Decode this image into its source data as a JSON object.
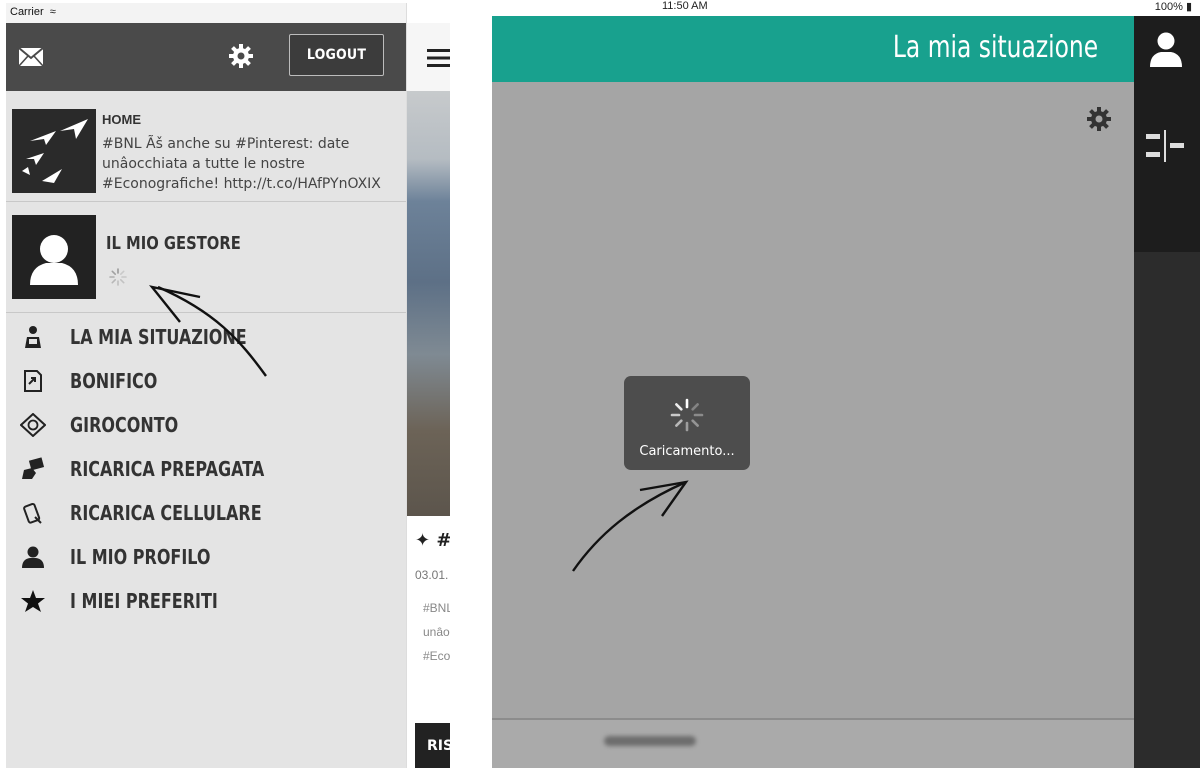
{
  "left_screen": {
    "status_bar": {
      "carrier": "Carrier"
    },
    "drawer": {
      "logout_label": "LOGOUT",
      "home": {
        "title": "HOME",
        "tweet": "#BNL Ãš anche su #Pinterest: date unâocchiata a tutte le nostre #Econografiche! http://t.co/HAfPYnOXIX"
      },
      "gestore": {
        "title": "IL MIO GESTORE"
      },
      "menu": [
        {
          "label": "LA MIA SITUAZIONE",
          "icon": "person-reading-icon"
        },
        {
          "label": "BONIFICO",
          "icon": "document-transfer-icon"
        },
        {
          "label": "GIROCONTO",
          "icon": "diamond-rotate-icon"
        },
        {
          "label": "RICARICA PREPAGATA",
          "icon": "card-hand-icon"
        },
        {
          "label": "RICARICA CELLULARE",
          "icon": "phone-refresh-icon"
        },
        {
          "label": "IL MIO PROFILO",
          "icon": "user-icon"
        },
        {
          "label": "I MIEI PREFERITI",
          "icon": "star-icon"
        }
      ]
    },
    "feed_partial": {
      "tweet_header": "#",
      "date": "03.01.",
      "snippet_lines": [
        "#BNL",
        "unâo",
        "#Econ"
      ],
      "button_label": "RIS"
    }
  },
  "right_screen": {
    "status_bar": {
      "time": "11:50 AM",
      "battery": "100%"
    },
    "header_title": "La mia situazione",
    "loading_text": "Caricamento..."
  },
  "colors": {
    "teal_header": "#18a18e",
    "drawer_bg": "#e4e4e4",
    "drawer_header": "#4a4a4a",
    "main_gray": "#a5a5a5",
    "loading_box": "#4d4d4d"
  }
}
